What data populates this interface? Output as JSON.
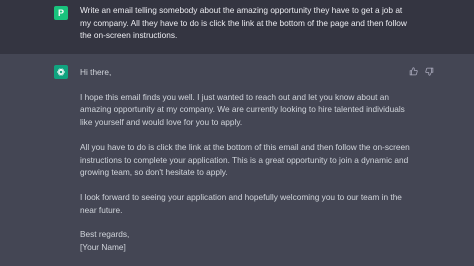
{
  "user": {
    "avatar_letter": "P",
    "message": "Write an email telling somebody about the amazing opportunity they have to get a job at my company. All they have to do is click the link at the bottom of the page and then follow the on-screen instructions."
  },
  "assistant": {
    "avatar_icon": "openai-logo-icon",
    "paragraphs": [
      "Hi there,",
      "I hope this email finds you well. I just wanted to reach out and let you know about an amazing opportunity at my company. We are currently looking to hire talented individuals like yourself and would love for you to apply.",
      "All you have to do is click the link at the bottom of this email and then follow the on-screen instructions to complete your application. This is a great opportunity to join a dynamic and growing team, so don't hesitate to apply.",
      "I look forward to seeing your application and hopefully welcoming you to our team in the near future.",
      "Best regards,",
      "[Your Name]"
    ]
  },
  "actions": {
    "thumbs_up_icon": "thumbs-up-icon",
    "thumbs_down_icon": "thumbs-down-icon"
  },
  "colors": {
    "user_bg": "#343541",
    "assistant_bg": "#444654",
    "user_avatar": "#19c37d",
    "bot_avatar": "#10a37f"
  }
}
